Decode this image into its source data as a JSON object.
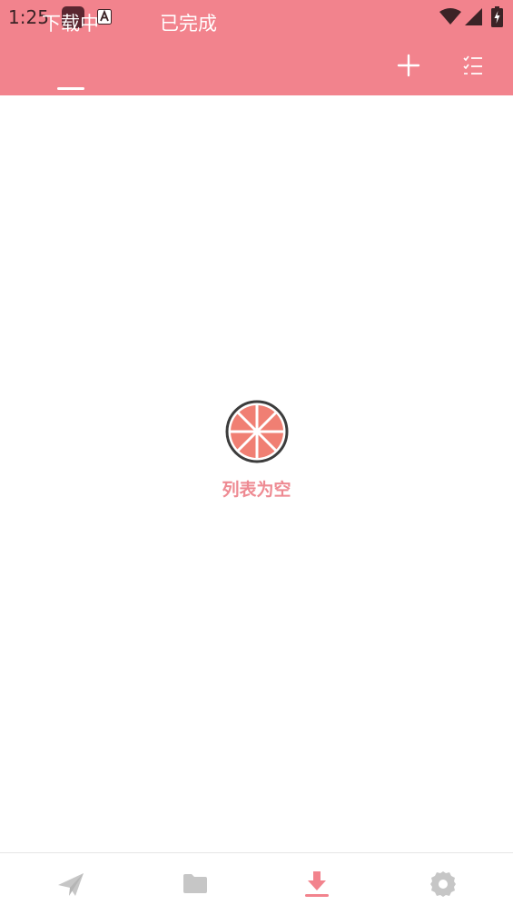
{
  "status_bar": {
    "time": "1:25",
    "icons": [
      "app-icon",
      "notification-a-icon",
      "wifi-icon",
      "signal-icon",
      "battery-charging-icon"
    ]
  },
  "header": {
    "tabs": [
      {
        "label": "下载中",
        "active": true
      },
      {
        "label": "已完成",
        "active": false
      }
    ],
    "actions": [
      "add-icon",
      "checklist-icon"
    ]
  },
  "empty_state": {
    "icon": "grapefruit-icon",
    "text": "列表为空"
  },
  "bottom_nav": {
    "items": [
      {
        "icon": "send-icon",
        "active": false
      },
      {
        "icon": "folder-icon",
        "active": false
      },
      {
        "icon": "download-icon",
        "active": true
      },
      {
        "icon": "settings-icon",
        "active": false
      }
    ]
  },
  "colors": {
    "accent": "#f2838d",
    "inactive_nav": "#c6c6c6",
    "empty_text": "#ee8a92"
  }
}
